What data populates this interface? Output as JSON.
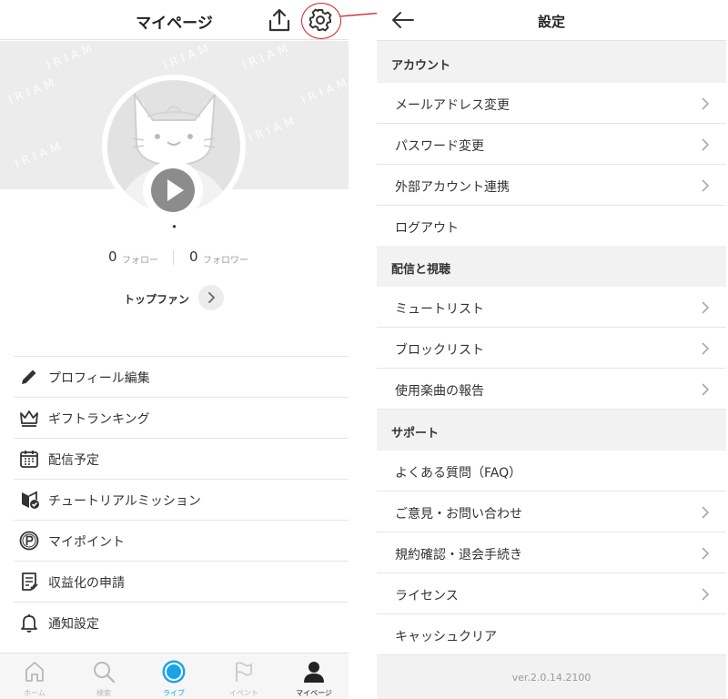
{
  "left": {
    "title": "マイページ",
    "watermark": "IRIAM",
    "username": "・",
    "following_count": "0",
    "following_label": "フォロー",
    "followers_count": "0",
    "followers_label": "フォロワー",
    "top_fan_label": "トップファン",
    "menu": [
      {
        "label": "プロフィール編集",
        "icon": "pencil-icon"
      },
      {
        "label": "ギフトランキング",
        "icon": "crown-icon"
      },
      {
        "label": "配信予定",
        "icon": "calendar-icon"
      },
      {
        "label": "チュートリアルミッション",
        "icon": "beginner-mark-icon"
      },
      {
        "label": "マイポイント",
        "icon": "point-coin-icon"
      },
      {
        "label": "収益化の申請",
        "icon": "document-check-icon"
      },
      {
        "label": "通知設定",
        "icon": "bell-icon"
      }
    ],
    "tabs": [
      {
        "label": "ホーム",
        "icon": "home-icon"
      },
      {
        "label": "検索",
        "icon": "search-icon"
      },
      {
        "label": "ライブ",
        "icon": "live-icon"
      },
      {
        "label": "イベント",
        "icon": "flag-icon"
      },
      {
        "label": "マイページ",
        "icon": "person-icon"
      }
    ]
  },
  "right": {
    "title": "設定",
    "sections": [
      {
        "header": "アカウント",
        "rows": [
          {
            "label": "メールアドレス変更",
            "chevron": true
          },
          {
            "label": "パスワード変更",
            "chevron": true
          },
          {
            "label": "外部アカウント連携",
            "chevron": true
          },
          {
            "label": "ログアウト",
            "chevron": false
          }
        ]
      },
      {
        "header": "配信と視聴",
        "rows": [
          {
            "label": "ミュートリスト",
            "chevron": true
          },
          {
            "label": "ブロックリスト",
            "chevron": true
          },
          {
            "label": "使用楽曲の報告",
            "chevron": true
          }
        ]
      },
      {
        "header": "サポート",
        "rows": [
          {
            "label": "よくある質問（FAQ）",
            "chevron": false
          },
          {
            "label": "ご意見・お問い合わせ",
            "chevron": true
          },
          {
            "label": "規約確認・退会手続き",
            "chevron": true
          },
          {
            "label": "ライセンス",
            "chevron": true
          },
          {
            "label": "キャッシュクリア",
            "chevron": false
          }
        ]
      }
    ],
    "version": "ver.2.0.14.2100"
  },
  "colors": {
    "accent_live": "#1aa3e8",
    "annotation_red": "#d0202a",
    "active_tab": "#222222",
    "inactive_tab": "#b8b8b8"
  }
}
